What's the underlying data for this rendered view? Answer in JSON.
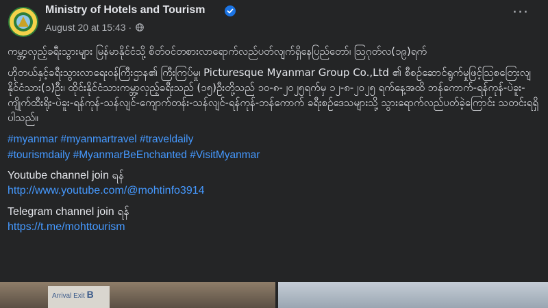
{
  "page": {
    "name": "Ministry of Hotels and Tourism",
    "timestamp": "August 20 at 15:43",
    "separator": "·",
    "more_label": "···"
  },
  "post": {
    "headline": "ကမ္ဘာ့လှည့်ခရီးသွားများ မြန်မာနိုင်ငံသို့ စိတ်ဝင်တစားလာရောက်လည်ပတ်လျက်ရှိနေပြည်တော်၊ ဩဂုတ်လ(၁၉)ရက်",
    "body": "ဟိုတယ်နှင့်ခရီးသွားလာရေးဝန်ကြီးဌာန၏ ကြီးကြပ်မှု၊ Picturesque Myanmar Group Co.,Ltd ၏ စီစဉ်ဆောင်ရွက်မှုဖြင့်ဩစတြေးလျနိုင်ငံသား(၁)ဦး၊ ထိုင်းနိုင်ငံသားကမ္ဘာ့လှည့်ခရီးသည် (၁၅)ဦးတို့သည် ၁၀-၈-၂၀၂၅ရက်မှ ၁၂-၈-၂၀၂၅ ရက်နေ့အထိ ဘန်ကောက်-ရန်ကုန်-ပဲခူး-ကျိုက်ထီးရိုး-ပဲခူး-ရန်ကုန်-သန်လျင်-ကျောက်တန်း-သန်လျင်-ရန်ကုန်-ဘန်ကောက် ခရီးစဉ်ဒေသများသို့ သွားရောက်လည်ပတ်ခဲ့ကြောင်း သတင်းရရှိပါသည်။",
    "hashtags_line1": "#myanmar #myanmartravel #traveldaily",
    "hashtags_line2": "#tourismdaily #MyanmarBeEnchanted #VisitMyanmar",
    "youtube_label": "Youtube channel join ရန်",
    "youtube_url": "http://www.youtube.com/@mohtinfo3914",
    "telegram_label": "Telegram  channel join ရန်",
    "telegram_url": "https://t.me/mohttourism"
  },
  "photos": {
    "sign_text": "Arrival Exit",
    "sign_letter": "B"
  },
  "colors": {
    "background": "#242526",
    "text": "#e4e6eb",
    "secondary": "#b0b3b8",
    "link": "#4599ff",
    "verified": "#1b74e4"
  },
  "icons": [
    "verified-badge-icon",
    "globe-icon",
    "more-options-icon"
  ]
}
